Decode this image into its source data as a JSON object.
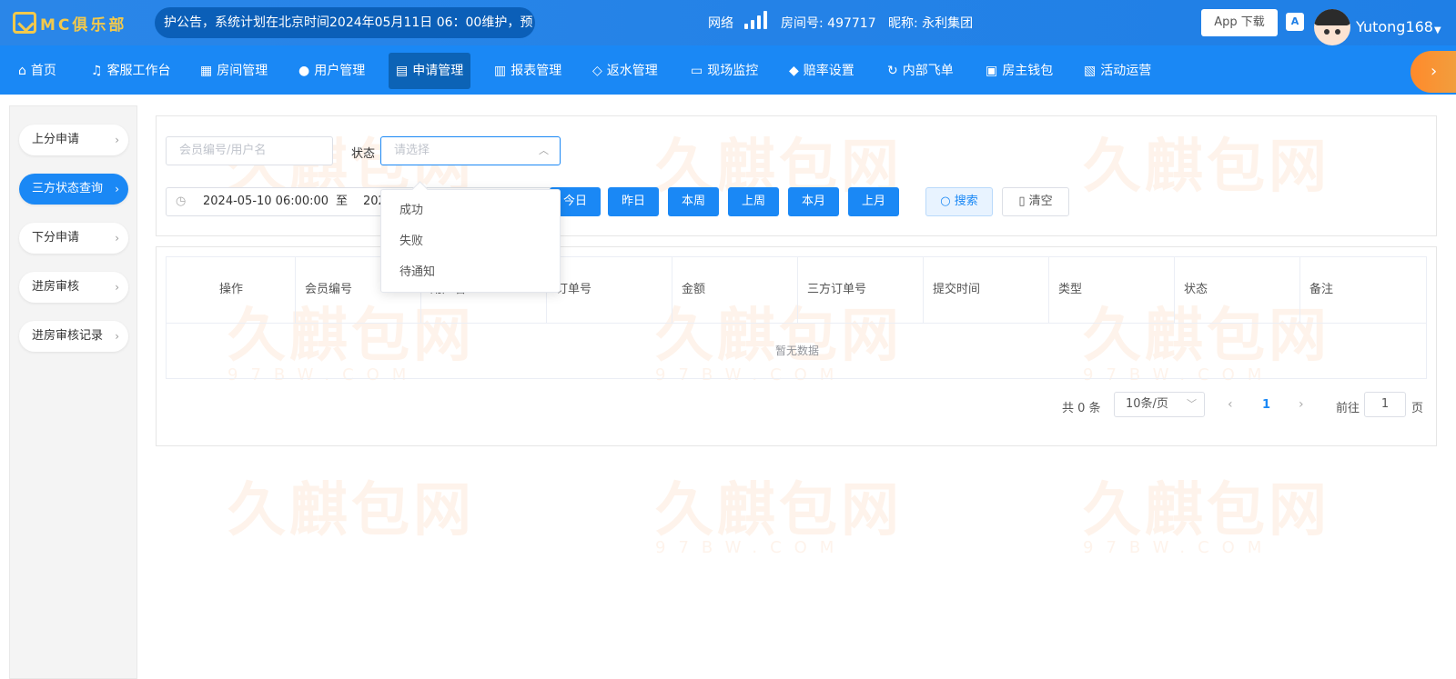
{
  "header": {
    "logo_text": "MC俱乐部",
    "notice": "护公告，系统计划在北京时间2024年05月11日 06：00维护，预",
    "network_label": "网络",
    "room_label": "房间号: 497717",
    "nickname_label": "昵称: 永利集团",
    "app_download": "App 下载",
    "lang_icon": "A",
    "username": "Yutong168"
  },
  "nav": {
    "items": [
      {
        "label": "首页",
        "icon": "home-icon"
      },
      {
        "label": "客服工作台",
        "icon": "headset-icon"
      },
      {
        "label": "房间管理",
        "icon": "grid-icon"
      },
      {
        "label": "用户管理",
        "icon": "user-icon"
      },
      {
        "label": "申请管理",
        "icon": "document-icon"
      },
      {
        "label": "报表管理",
        "icon": "bar-chart-icon"
      },
      {
        "label": "返水管理",
        "icon": "tag-icon"
      },
      {
        "label": "现场监控",
        "icon": "monitor-icon"
      },
      {
        "label": "赔率设置",
        "icon": "shield-icon"
      },
      {
        "label": "内部飞单",
        "icon": "refresh-icon"
      },
      {
        "label": "房主钱包",
        "icon": "wallet-icon"
      },
      {
        "label": "活动运营",
        "icon": "gift-icon"
      }
    ],
    "active_index": 4
  },
  "sidebar": {
    "items": [
      {
        "label": "上分申请"
      },
      {
        "label": "三方状态查询"
      },
      {
        "label": "下分申请"
      },
      {
        "label": "进房审核"
      },
      {
        "label": "进房审核记录"
      }
    ],
    "active_index": 1
  },
  "filters": {
    "member_placeholder": "会员编号/用户名",
    "status_label": "状态",
    "status_placeholder": "请选择",
    "date_start": "2024-05-10 06:00:00",
    "date_sep": "至",
    "date_end": "202",
    "quick_buttons": [
      "今日",
      "昨日",
      "本周",
      "上周",
      "本月",
      "上月"
    ],
    "search": "搜索",
    "clear": "清空"
  },
  "status_dropdown": {
    "options": [
      "成功",
      "失败",
      "待通知"
    ]
  },
  "table": {
    "columns": [
      "操作",
      "会员编号",
      "用户名",
      "订单号",
      "金额",
      "三方订单号",
      "提交时间",
      "类型",
      "状态",
      "备注"
    ],
    "empty_text": "暂无数据"
  },
  "pagination": {
    "total": "共 0 条",
    "page_size": "10条/页",
    "current": "1",
    "goto_label": "前往",
    "goto_value": "1",
    "page_suffix": "页"
  },
  "watermark": {
    "text": "久麒包网",
    "sub": "97BW.COM"
  },
  "colors": {
    "primary": "#1a88f5",
    "header": "#2a86e8",
    "active_nav": "#0c63b6",
    "accent_orange": "#ff8a2b"
  }
}
